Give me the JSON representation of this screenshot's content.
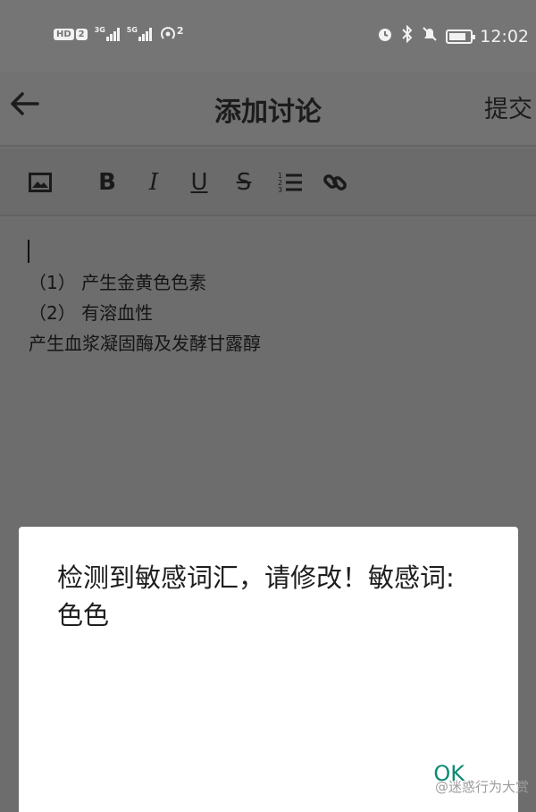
{
  "status_bar": {
    "hd_label": "HD",
    "sim_label": "2",
    "net1_label": "3G",
    "net2_label": "5G",
    "hotspot_count": "2",
    "time": "12:02"
  },
  "app_bar": {
    "title": "添加讨论",
    "submit_label": "提交"
  },
  "toolbar": {
    "bold_label": "B",
    "italic_label": "I",
    "underline_label": "U",
    "strike_label": "S"
  },
  "editor": {
    "lines": [
      "（1） 产生金黄色色素",
      "（2） 有溶血性",
      "产生血浆凝固酶及发酵甘露醇"
    ]
  },
  "dialog": {
    "message": "检测到敏感词汇，请修改！敏感词: 色色",
    "ok_label": "OK"
  },
  "watermark": {
    "text": "@迷惑行为大赏"
  },
  "colors": {
    "accent": "#0e8a74",
    "overlay": "#6f6f6f",
    "dialog_bg": "#ffffff"
  },
  "icons": [
    "image-icon",
    "ordered-list-icon",
    "link-icon",
    "back-arrow-icon",
    "alarm-icon",
    "bluetooth-icon",
    "mute-icon",
    "battery-icon",
    "hotspot-icon",
    "signal-icon"
  ]
}
